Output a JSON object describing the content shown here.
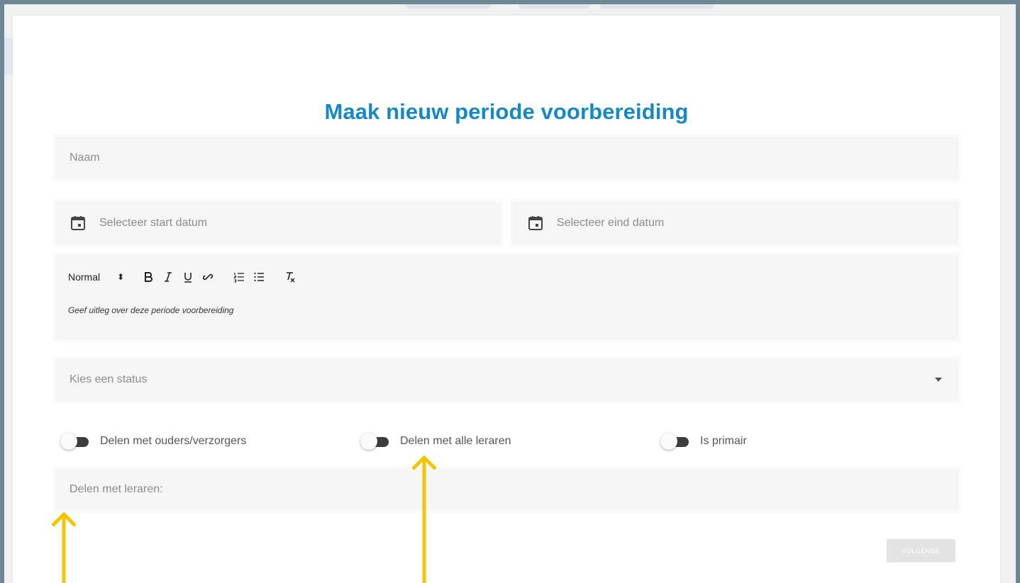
{
  "dialog": {
    "title": "Maak nieuw periode voorbereiding"
  },
  "form": {
    "name_placeholder": "Naam",
    "start_date_placeholder": "Selecteer start datum",
    "end_date_placeholder": "Selecteer eind datum",
    "editor": {
      "format_select": "Normal",
      "buttons": [
        "bold",
        "italic",
        "underline",
        "link",
        "ordered-list",
        "bullet-list",
        "clear-format"
      ],
      "placeholder": "Geef uitleg over deze periode voorbereiding"
    },
    "status_placeholder": "Kies een status",
    "toggles": [
      {
        "label": "Delen met ouders/verzorgers",
        "on": false
      },
      {
        "label": "Delen met alle leraren",
        "on": false
      },
      {
        "label": "Is primair",
        "on": false
      }
    ],
    "teachers_label": "Delen met leraren:",
    "next_button": "VOLGENDE"
  },
  "colors": {
    "title": "#1688c4",
    "annotation_arrow": "#f5c400",
    "field_bg": "#f5f5f5"
  },
  "annotations": {
    "arrows": [
      "annotation-arrow",
      "annotation-arrow"
    ]
  }
}
